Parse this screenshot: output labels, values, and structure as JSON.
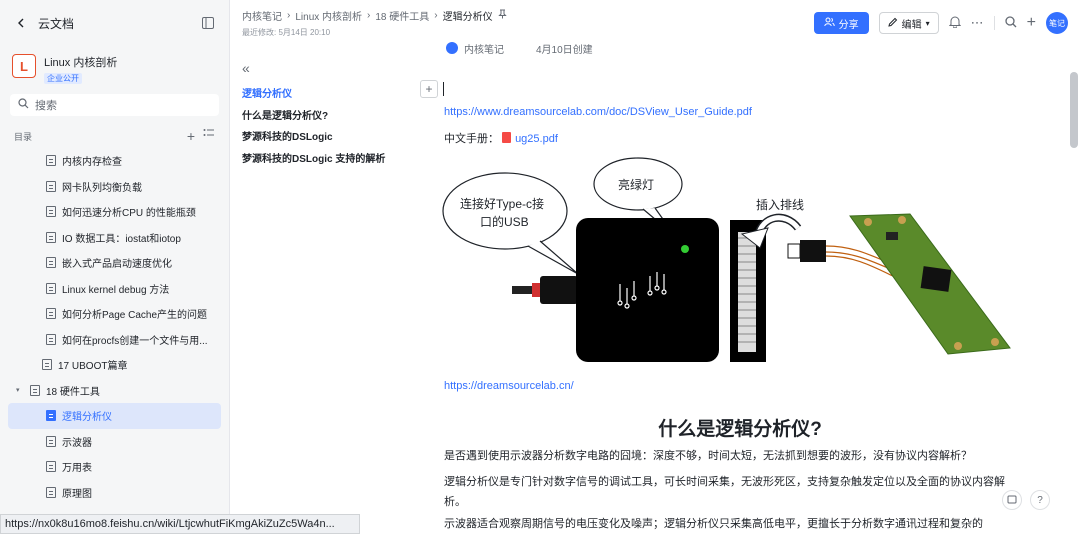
{
  "app": {
    "back_label": "云文档"
  },
  "space": {
    "logo_letter": "L",
    "title": "Linux 内核剖析",
    "badge": "企业公开"
  },
  "search": {
    "placeholder": "搜索"
  },
  "toc": {
    "label": "目录"
  },
  "tree": [
    {
      "label": "内核内存检查",
      "level": 2,
      "active": false
    },
    {
      "label": "网卡队列均衡负载",
      "level": 2,
      "active": false
    },
    {
      "label": "如何迅速分析CPU 的性能瓶颈",
      "level": 2,
      "active": false
    },
    {
      "label": "IO 数据工具：iostat和iotop",
      "level": 2,
      "active": false
    },
    {
      "label": "嵌入式产品启动速度优化",
      "level": 2,
      "active": false
    },
    {
      "label": "Linux kernel debug 方法",
      "level": 2,
      "active": false
    },
    {
      "label": "如何分析Page Cache产生的问题",
      "level": 2,
      "active": false
    },
    {
      "label": "如何在procfs创建一个文件与用...",
      "level": 2,
      "active": false
    },
    {
      "label": "17 UBOOT篇章",
      "level": 1,
      "active": false
    },
    {
      "label": "18 硬件工具",
      "level": 1,
      "active": false,
      "expanded": true
    },
    {
      "label": "逻辑分析仪",
      "level": 2,
      "active": true
    },
    {
      "label": "示波器",
      "level": 2,
      "active": false
    },
    {
      "label": "万用表",
      "level": 2,
      "active": false
    },
    {
      "label": "原理图",
      "level": 2,
      "active": false
    }
  ],
  "status_url": "https://nx0k8u16mo8.feishu.cn/wiki/LtjcwhutFiKmgAkiZuZc5Wa4n...",
  "header": {
    "crumbs": [
      "内核笔记",
      "Linux 内核剖析",
      "18 硬件工具",
      "逻辑分析仪"
    ],
    "meta": "最近修改: 5月14日 20:10",
    "share_label": "分享",
    "edit_label": "编辑",
    "avatar_text": "笔记"
  },
  "outline": [
    {
      "label": "逻辑分析仪",
      "active": true
    },
    {
      "label": "什么是逻辑分析仪?",
      "active": false
    },
    {
      "label": "梦源科技的DSLogic",
      "active": false
    },
    {
      "label": "梦源科技的DSLogic 支持的解析",
      "active": false
    }
  ],
  "doc": {
    "author": "内核笔记",
    "created": "4月10日创建",
    "guide_url": "https://www.dreamsourcelab.com/doc/DSView_User_Guide.pdf",
    "manual_label": "中文手册：",
    "manual_file": "ug25.pdf",
    "illustration": {
      "bubble_usb": [
        "连接好Type-c接",
        "口的USB"
      ],
      "bubble_led": "亮绿灯",
      "cable_label": "插入排线"
    },
    "site_url": "https://dreamsourcelab.cn/",
    "heading": "什么是逻辑分析仪?",
    "paragraphs": [
      "是否遇到使用示波器分析数字电路的囧境：深度不够，时间太短，无法抓到想要的波形，没有协议内容解析？",
      "逻辑分析仪是专门针对数字信号的调试工具，可长时间采集，无波形死区，支持复杂触发定位以及全面的协议内容解析。",
      "示波器适合观察周期信号的电压变化及噪声；逻辑分析仪只采集高低电平，更擅长于分析数字通讯过程和复杂的"
    ]
  }
}
